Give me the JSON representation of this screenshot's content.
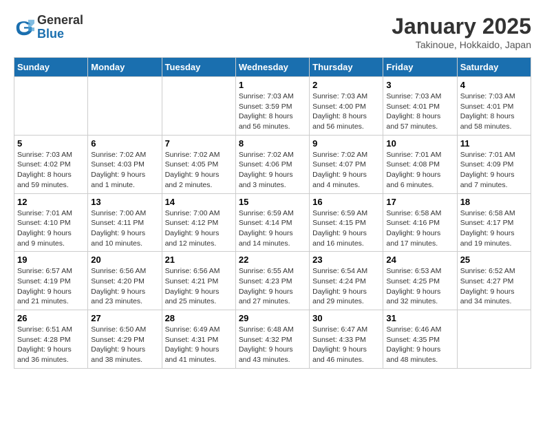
{
  "header": {
    "logo_general": "General",
    "logo_blue": "Blue",
    "title": "January 2025",
    "subtitle": "Takinoue, Hokkaido, Japan"
  },
  "weekdays": [
    "Sunday",
    "Monday",
    "Tuesday",
    "Wednesday",
    "Thursday",
    "Friday",
    "Saturday"
  ],
  "weeks": [
    [
      {
        "day": "",
        "info": ""
      },
      {
        "day": "",
        "info": ""
      },
      {
        "day": "",
        "info": ""
      },
      {
        "day": "1",
        "info": "Sunrise: 7:03 AM\nSunset: 3:59 PM\nDaylight: 8 hours\nand 56 minutes."
      },
      {
        "day": "2",
        "info": "Sunrise: 7:03 AM\nSunset: 4:00 PM\nDaylight: 8 hours\nand 56 minutes."
      },
      {
        "day": "3",
        "info": "Sunrise: 7:03 AM\nSunset: 4:01 PM\nDaylight: 8 hours\nand 57 minutes."
      },
      {
        "day": "4",
        "info": "Sunrise: 7:03 AM\nSunset: 4:01 PM\nDaylight: 8 hours\nand 58 minutes."
      }
    ],
    [
      {
        "day": "5",
        "info": "Sunrise: 7:03 AM\nSunset: 4:02 PM\nDaylight: 8 hours\nand 59 minutes."
      },
      {
        "day": "6",
        "info": "Sunrise: 7:02 AM\nSunset: 4:03 PM\nDaylight: 9 hours\nand 1 minute."
      },
      {
        "day": "7",
        "info": "Sunrise: 7:02 AM\nSunset: 4:05 PM\nDaylight: 9 hours\nand 2 minutes."
      },
      {
        "day": "8",
        "info": "Sunrise: 7:02 AM\nSunset: 4:06 PM\nDaylight: 9 hours\nand 3 minutes."
      },
      {
        "day": "9",
        "info": "Sunrise: 7:02 AM\nSunset: 4:07 PM\nDaylight: 9 hours\nand 4 minutes."
      },
      {
        "day": "10",
        "info": "Sunrise: 7:01 AM\nSunset: 4:08 PM\nDaylight: 9 hours\nand 6 minutes."
      },
      {
        "day": "11",
        "info": "Sunrise: 7:01 AM\nSunset: 4:09 PM\nDaylight: 9 hours\nand 7 minutes."
      }
    ],
    [
      {
        "day": "12",
        "info": "Sunrise: 7:01 AM\nSunset: 4:10 PM\nDaylight: 9 hours\nand 9 minutes."
      },
      {
        "day": "13",
        "info": "Sunrise: 7:00 AM\nSunset: 4:11 PM\nDaylight: 9 hours\nand 10 minutes."
      },
      {
        "day": "14",
        "info": "Sunrise: 7:00 AM\nSunset: 4:12 PM\nDaylight: 9 hours\nand 12 minutes."
      },
      {
        "day": "15",
        "info": "Sunrise: 6:59 AM\nSunset: 4:14 PM\nDaylight: 9 hours\nand 14 minutes."
      },
      {
        "day": "16",
        "info": "Sunrise: 6:59 AM\nSunset: 4:15 PM\nDaylight: 9 hours\nand 16 minutes."
      },
      {
        "day": "17",
        "info": "Sunrise: 6:58 AM\nSunset: 4:16 PM\nDaylight: 9 hours\nand 17 minutes."
      },
      {
        "day": "18",
        "info": "Sunrise: 6:58 AM\nSunset: 4:17 PM\nDaylight: 9 hours\nand 19 minutes."
      }
    ],
    [
      {
        "day": "19",
        "info": "Sunrise: 6:57 AM\nSunset: 4:19 PM\nDaylight: 9 hours\nand 21 minutes."
      },
      {
        "day": "20",
        "info": "Sunrise: 6:56 AM\nSunset: 4:20 PM\nDaylight: 9 hours\nand 23 minutes."
      },
      {
        "day": "21",
        "info": "Sunrise: 6:56 AM\nSunset: 4:21 PM\nDaylight: 9 hours\nand 25 minutes."
      },
      {
        "day": "22",
        "info": "Sunrise: 6:55 AM\nSunset: 4:23 PM\nDaylight: 9 hours\nand 27 minutes."
      },
      {
        "day": "23",
        "info": "Sunrise: 6:54 AM\nSunset: 4:24 PM\nDaylight: 9 hours\nand 29 minutes."
      },
      {
        "day": "24",
        "info": "Sunrise: 6:53 AM\nSunset: 4:25 PM\nDaylight: 9 hours\nand 32 minutes."
      },
      {
        "day": "25",
        "info": "Sunrise: 6:52 AM\nSunset: 4:27 PM\nDaylight: 9 hours\nand 34 minutes."
      }
    ],
    [
      {
        "day": "26",
        "info": "Sunrise: 6:51 AM\nSunset: 4:28 PM\nDaylight: 9 hours\nand 36 minutes."
      },
      {
        "day": "27",
        "info": "Sunrise: 6:50 AM\nSunset: 4:29 PM\nDaylight: 9 hours\nand 38 minutes."
      },
      {
        "day": "28",
        "info": "Sunrise: 6:49 AM\nSunset: 4:31 PM\nDaylight: 9 hours\nand 41 minutes."
      },
      {
        "day": "29",
        "info": "Sunrise: 6:48 AM\nSunset: 4:32 PM\nDaylight: 9 hours\nand 43 minutes."
      },
      {
        "day": "30",
        "info": "Sunrise: 6:47 AM\nSunset: 4:33 PM\nDaylight: 9 hours\nand 46 minutes."
      },
      {
        "day": "31",
        "info": "Sunrise: 6:46 AM\nSunset: 4:35 PM\nDaylight: 9 hours\nand 48 minutes."
      },
      {
        "day": "",
        "info": ""
      }
    ]
  ]
}
